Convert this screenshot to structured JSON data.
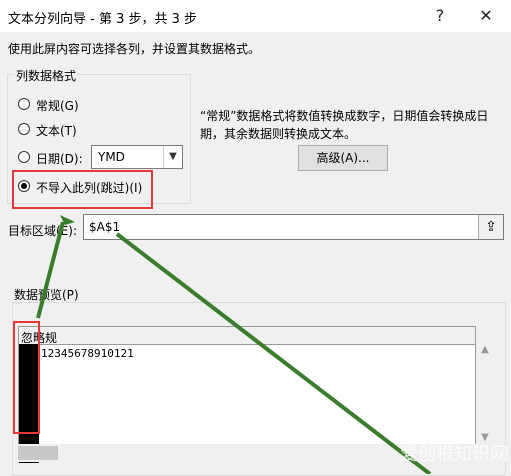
{
  "window": {
    "title": "文本分列向导 - 第 3 步，共 3 步",
    "help_glyph": "?",
    "close_glyph": "✕"
  },
  "instruction": "使用此屏内容可选择各列，并设置其数据格式。",
  "format_group": {
    "label": "列数据格式",
    "options": [
      {
        "label": "常规(G)",
        "selected": false
      },
      {
        "label": "文本(T)",
        "selected": false
      },
      {
        "label": "日期(D):",
        "selected": false
      },
      {
        "label": "不导入此列(跳过)(I)",
        "selected": true
      }
    ],
    "date_combo_value": "YMD"
  },
  "description": "“常规”数据格式将数值转换成数字，日期值会转换成日期，其余数据则转换成文本。",
  "advanced_button": "高级(A)...",
  "destination": {
    "label": "目标区域(E):",
    "value": "$A$1",
    "picker_glyph": "⇪"
  },
  "preview": {
    "label": "数据预览(P)",
    "header": "忽略规",
    "row": "12345678910121"
  },
  "watermark": "爱创根知识网",
  "colors": {
    "highlight_box": "#e53935",
    "arrow": "#3a7d2c"
  }
}
